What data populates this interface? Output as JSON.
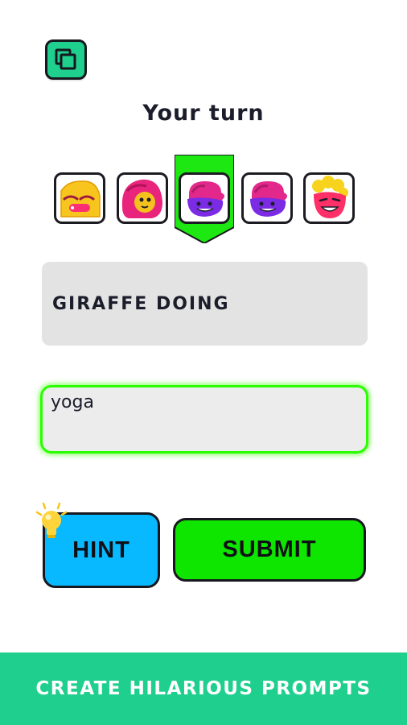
{
  "header": {
    "title": "Your turn",
    "gallery_icon": "stacked-squares-icon"
  },
  "players": {
    "active_index": 2,
    "avatars": [
      {
        "icon": "yellow-blob-avatar-icon",
        "colors": [
          "#f7c51e",
          "#ff2f73"
        ]
      },
      {
        "icon": "pink-hair-avatar-icon",
        "colors": [
          "#e8247d",
          "#f5c11c"
        ]
      },
      {
        "icon": "purple-cap-avatar-icon",
        "colors": [
          "#7a2be3",
          "#e3288c"
        ]
      },
      {
        "icon": "purple-cap-avatar-icon",
        "colors": [
          "#7a2be3",
          "#e3288c"
        ]
      },
      {
        "icon": "yellow-hair-avatar-icon",
        "colors": [
          "#f8d31d",
          "#ff2f67"
        ]
      }
    ],
    "turn_marker_color": "#1ee812"
  },
  "prompt": {
    "text": "GIRAFFE DOING"
  },
  "answer": {
    "value": "yoga"
  },
  "buttons": {
    "hint_label": "HINT",
    "hint_icon": "lightbulb-icon",
    "submit_label": "SUBMIT"
  },
  "footer": {
    "text": "CREATE HILARIOUS PROMPTS"
  },
  "colors": {
    "accent": "#1fcf8e",
    "hint": "#09b9ff",
    "submit": "#0ee600",
    "input_glow": "#2aff00"
  }
}
